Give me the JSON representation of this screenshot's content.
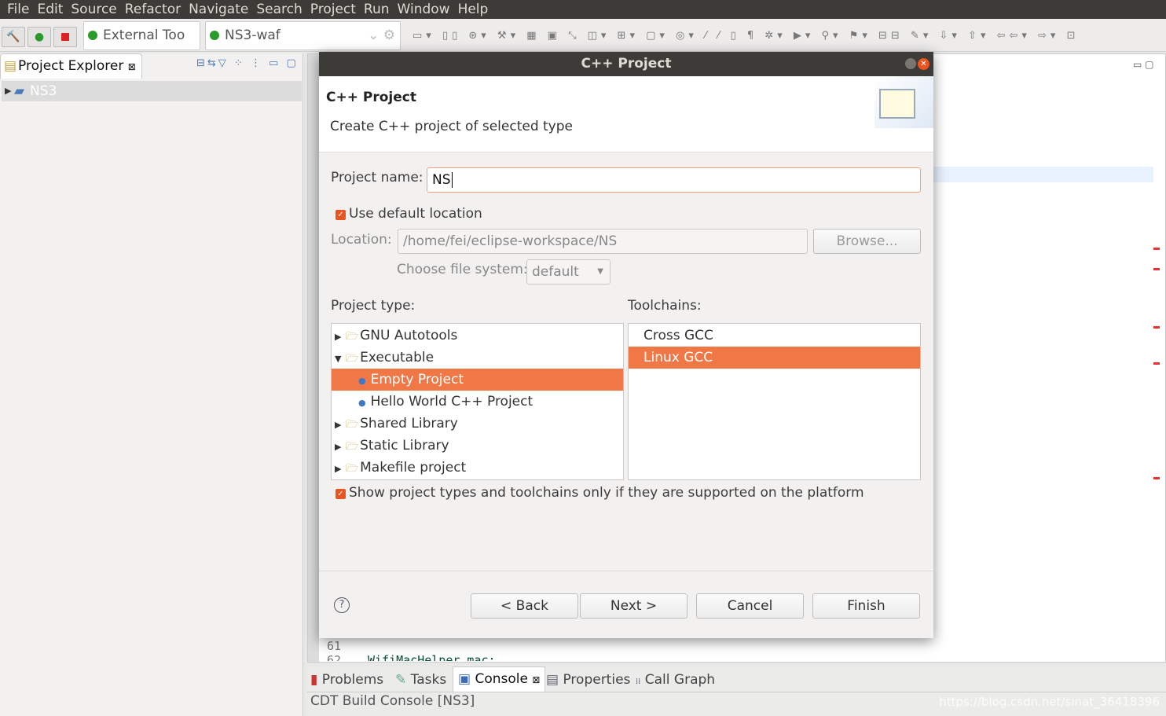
{
  "menu": [
    "File",
    "Edit",
    "Source",
    "Refactor",
    "Navigate",
    "Search",
    "Project",
    "Run",
    "Window",
    "Help"
  ],
  "toolbar": {
    "launch_mode": "External Too",
    "launch_config": "NS3-waf"
  },
  "explorer": {
    "tab": "Project Explorer",
    "items": [
      {
        "label": "NS3"
      }
    ]
  },
  "editor": {
    "line61": "61",
    "line62": "62",
    "code62": "WifiMacHelper mac;"
  },
  "bottom": {
    "tabs": [
      "Problems",
      "Tasks",
      "Console",
      "Properties",
      "Call Graph"
    ],
    "active": "Console",
    "console_title": "CDT Build Console [NS3]",
    "watermark": "https://blog.csdn.net/sinat_36418396"
  },
  "dialog": {
    "window_title": "C++ Project",
    "header_title": "C++ Project",
    "header_desc": "Create C++ project of selected type",
    "project_name_label": "Project name:",
    "project_name": "NS",
    "use_default_label": "Use default location",
    "use_default": true,
    "location_label": "Location:",
    "location": "/home/fei/eclipse-workspace/NS",
    "browse": "Browse...",
    "fs_label": "Choose file system:",
    "fs_value": "default",
    "project_type_label": "Project type:",
    "toolchains_label": "Toolchains:",
    "project_types": [
      {
        "label": "GNU Autotools",
        "kind": "folder",
        "expanded": false
      },
      {
        "label": "Executable",
        "kind": "folder",
        "expanded": true
      },
      {
        "label": "Empty Project",
        "kind": "leaf",
        "selected": true
      },
      {
        "label": "Hello World C++ Project",
        "kind": "leaf"
      },
      {
        "label": "Shared Library",
        "kind": "folder",
        "expanded": false
      },
      {
        "label": "Static Library",
        "kind": "folder",
        "expanded": false
      },
      {
        "label": "Makefile project",
        "kind": "folder",
        "expanded": false
      }
    ],
    "toolchains": [
      {
        "label": "Cross GCC"
      },
      {
        "label": "Linux GCC",
        "selected": true
      }
    ],
    "show_supported_label": "Show project types and toolchains only if they are supported on the platform",
    "show_supported": true,
    "back": "< Back",
    "next": "Next >",
    "cancel": "Cancel",
    "finish": "Finish"
  },
  "colors": {
    "accent": "#f07746",
    "titlebar": "#3c3b37"
  }
}
